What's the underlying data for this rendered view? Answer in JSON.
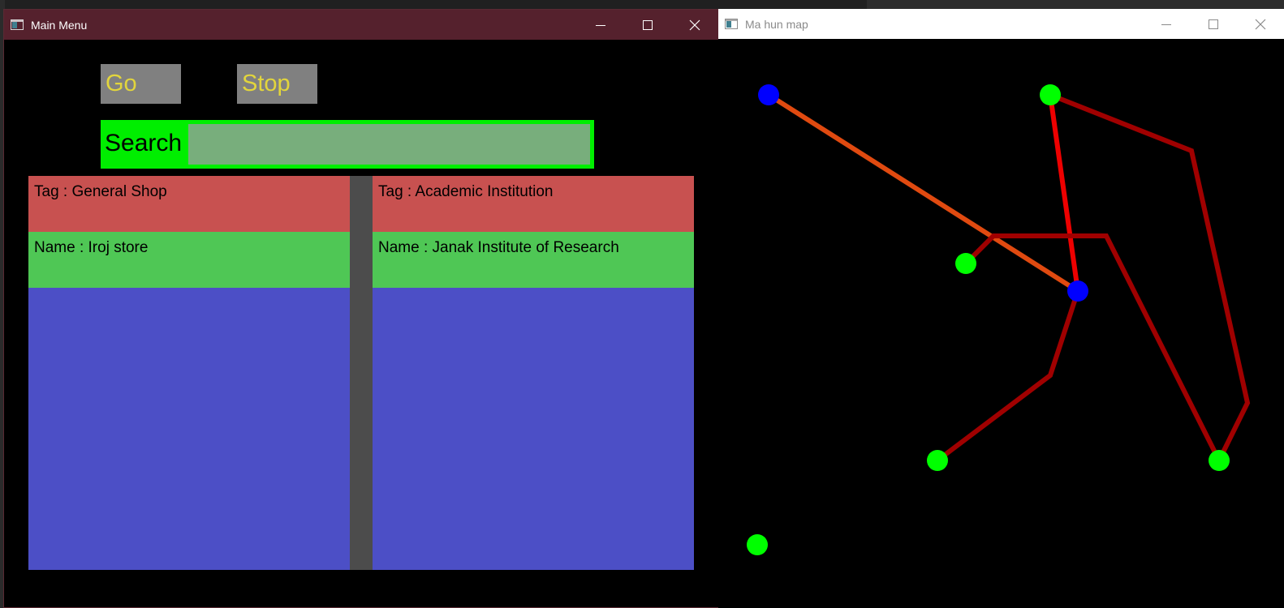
{
  "windows": {
    "main": {
      "title": "Main Menu",
      "go_label": "Go",
      "stop_label": "Stop",
      "search": {
        "label": "Search",
        "value": ""
      },
      "cards": [
        {
          "tag": "Tag : General Shop",
          "name": "Name : Iroj store"
        },
        {
          "tag": "Tag : Academic Institution",
          "name": "Name : Janak Institute of Research"
        }
      ]
    },
    "map": {
      "title": "Ma hun map"
    }
  },
  "colors": {
    "main_titlebar": "#55212d",
    "button_bg": "#808080",
    "button_text": "#e2d53c",
    "search_bg": "#00ee00",
    "search_field": "#78ae7c",
    "tag_row": "#c85150",
    "name_row": "#4fc755",
    "card_body": "#4c4fc6",
    "node_selected": "#0000ff",
    "node_default": "#00ff00",
    "route_primary": "#e04a10",
    "route_active": "#ee0000",
    "edge": "#a00000"
  },
  "map": {
    "nodes": [
      {
        "id": "n1",
        "type": "selected"
      },
      {
        "id": "n2",
        "type": "default"
      },
      {
        "id": "n3",
        "type": "default"
      },
      {
        "id": "n4",
        "type": "selected"
      },
      {
        "id": "n5",
        "type": "default"
      },
      {
        "id": "n6",
        "type": "default"
      },
      {
        "id": "n7",
        "type": "default"
      }
    ],
    "edges": [
      {
        "from": "n1",
        "to": "n4",
        "style": "route_primary"
      },
      {
        "from": "n2",
        "to": "n4",
        "style": "route_active"
      },
      {
        "from": "n2",
        "to": "n6",
        "style": "edge",
        "via": "bend_right"
      },
      {
        "from": "n3",
        "to": "n6",
        "style": "edge",
        "via": "bend_mid"
      },
      {
        "from": "n4",
        "to": "n5",
        "style": "edge",
        "via": "bend_low"
      }
    ]
  }
}
